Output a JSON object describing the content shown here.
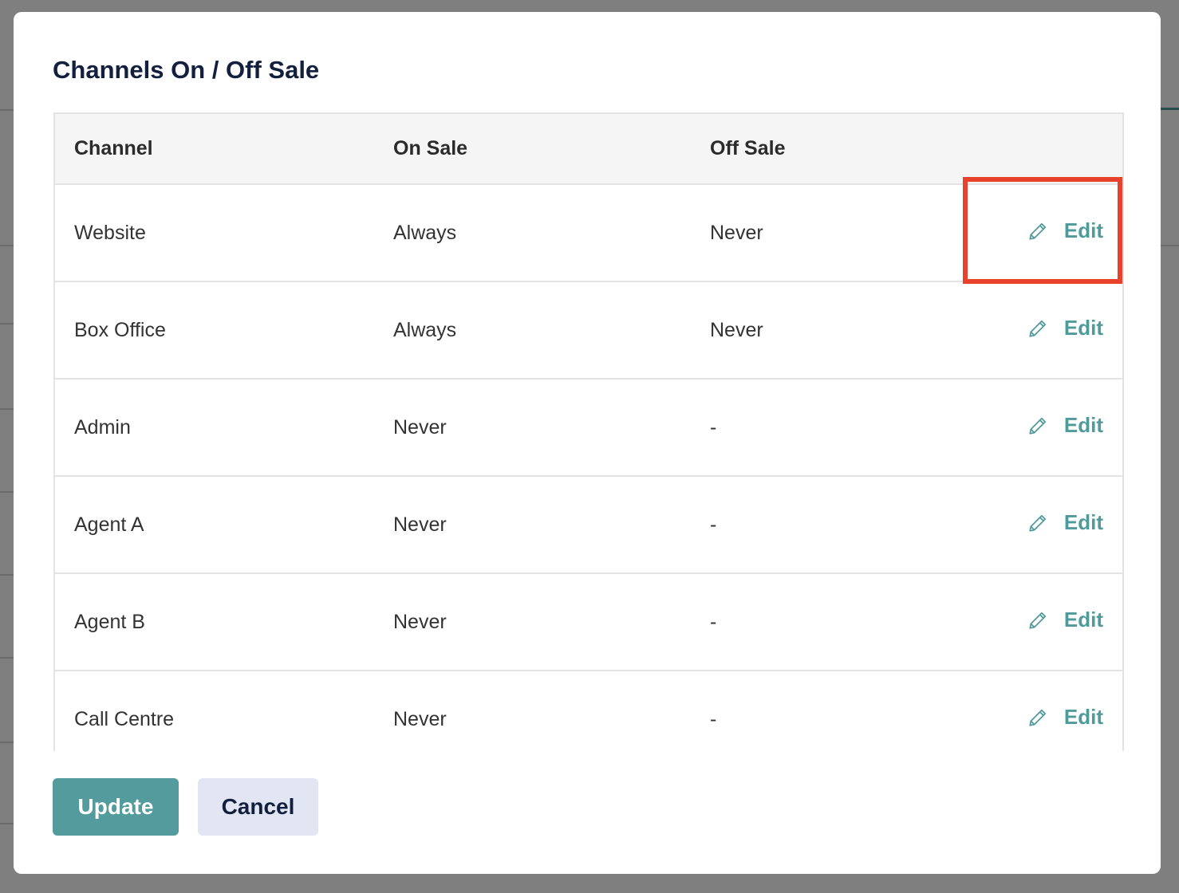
{
  "modal": {
    "title": "Channels On / Off Sale",
    "columns": {
      "channel": "Channel",
      "on_sale": "On Sale",
      "off_sale": "Off Sale"
    },
    "rows": [
      {
        "channel": "Website",
        "on_sale": "Always",
        "off_sale": "Never",
        "action": "Edit"
      },
      {
        "channel": "Box Office",
        "on_sale": "Always",
        "off_sale": "Never",
        "action": "Edit"
      },
      {
        "channel": "Admin",
        "on_sale": "Never",
        "off_sale": "-",
        "action": "Edit"
      },
      {
        "channel": "Agent A",
        "on_sale": "Never",
        "off_sale": "-",
        "action": "Edit"
      },
      {
        "channel": "Agent B",
        "on_sale": "Never",
        "off_sale": "-",
        "action": "Edit"
      },
      {
        "channel": "Call Centre",
        "on_sale": "Never",
        "off_sale": "-",
        "action": "Edit"
      }
    ],
    "buttons": {
      "update": "Update",
      "cancel": "Cancel"
    }
  },
  "colors": {
    "accent": "#539b9d",
    "link": "#4f9a9b",
    "title": "#13203d",
    "highlight": "#e8412c",
    "cancel_bg": "#e2e6f3"
  },
  "icons": {
    "edit": "pencil-icon"
  }
}
